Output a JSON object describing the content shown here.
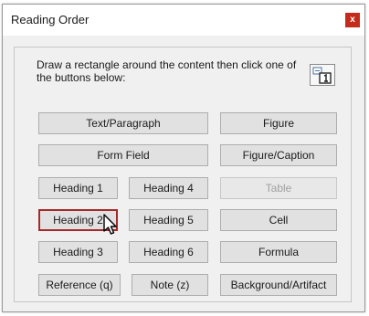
{
  "window": {
    "title": "Reading Order",
    "close_label": "x"
  },
  "instruction": "Draw a rectangle around the content then click one of the buttons below:",
  "icons": {
    "tool": "reading-order-tool-icon",
    "cursor": "mouse-pointer-icon"
  },
  "buttons": {
    "text_paragraph": "Text/Paragraph",
    "figure": "Figure",
    "form_field": "Form Field",
    "figure_caption": "Figure/Caption",
    "heading1": "Heading 1",
    "heading4": "Heading 4",
    "table": "Table",
    "heading2": "Heading 2",
    "heading5": "Heading 5",
    "cell": "Cell",
    "heading3": "Heading 3",
    "heading6": "Heading 6",
    "formula": "Formula",
    "reference": "Reference (q)",
    "note": "Note (z)",
    "background_artifact": "Background/Artifact"
  },
  "colors": {
    "close_button": "#c42b1c",
    "focus_border": "#a52a2a"
  }
}
